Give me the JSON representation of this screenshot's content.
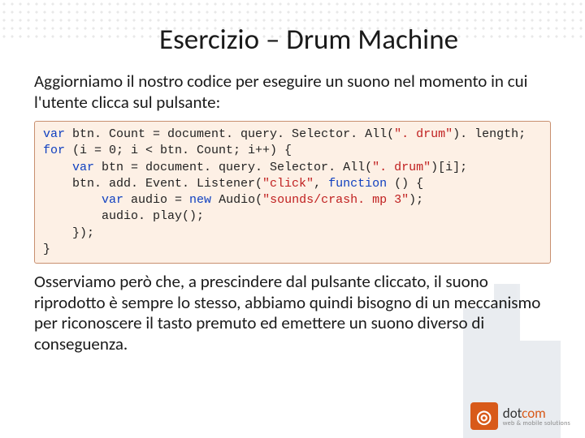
{
  "title": "Esercizio – Drum Machine",
  "intro": "Aggiorniamo il nostro codice per eseguire un suono nel momento in cui l'utente clicca sul pulsante:",
  "code": {
    "l1a": "var",
    "l1b": " btn. Count = document. query. Selector. All(",
    "l1c": "\". drum\"",
    "l1d": "). length;",
    "l2a": "for",
    "l2b": " (i = 0; i < btn. Count; i++) {",
    "l3a": "    var",
    "l3b": " btn = document. query. Selector. All(",
    "l3c": "\". drum\"",
    "l3d": ")[i];",
    "l4a": "    btn. add. Event. Listener(",
    "l4b": "\"click\"",
    "l4c": ", ",
    "l4d": "function",
    "l4e": " () {",
    "l5a": "        var",
    "l5b": " audio = ",
    "l5c": "new",
    "l5d": " Audio(",
    "l5e": "\"sounds/crash. mp 3\"",
    "l5f": ");",
    "l6": "        audio. play();",
    "l7": "    });",
    "l8": "}"
  },
  "outro": "Osserviamo però che, a prescindere dal pulsante cliccato, il suono riprodotto è sempre lo stesso, abbiamo quindi bisogno di un meccanismo per riconoscere il tasto premuto ed emettere un suono diverso di conseguenza.",
  "logo": {
    "dot": "dot",
    "com": "com",
    "tagline": "web & mobile solutions"
  }
}
